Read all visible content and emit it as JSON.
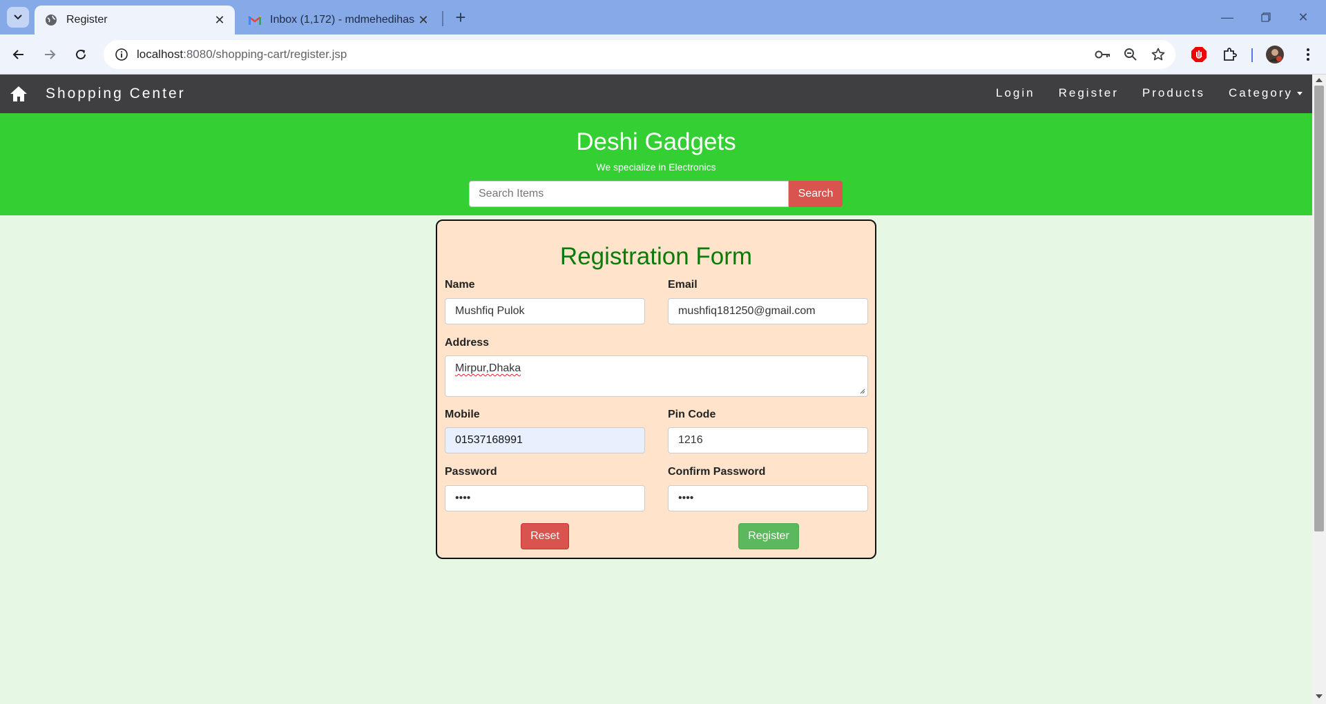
{
  "browser": {
    "tabs": [
      {
        "title": "Register",
        "active": true
      },
      {
        "title": "Inbox (1,172) - mdmehedihasan",
        "active": false
      }
    ],
    "url_host": "localhost",
    "url_path": ":8080/shopping-cart/register.jsp"
  },
  "navbar": {
    "brand": "Shopping Center",
    "links": [
      "Login",
      "Register",
      "Products",
      "Category"
    ]
  },
  "banner": {
    "title": "Deshi Gadgets",
    "subtitle": "We specialize in Electronics",
    "search_placeholder": "Search Items",
    "search_button": "Search"
  },
  "form": {
    "title": "Registration Form",
    "name_label": "Name",
    "name_value": "Mushfiq Pulok",
    "email_label": "Email",
    "email_value": "mushfiq181250@gmail.com",
    "address_label": "Address",
    "address_value": "Mirpur,Dhaka",
    "mobile_label": "Mobile",
    "mobile_value": "01537168991",
    "pincode_label": "Pin Code",
    "pincode_value": "1216",
    "password_label": "Password",
    "password_value": "••••",
    "confirm_label": "Confirm Password",
    "confirm_value": "••••",
    "reset_button": "Reset",
    "register_button": "Register"
  },
  "colors": {
    "navbar": "#3f3f41",
    "banner": "#33cf33",
    "form_bg": "#ffe3ca",
    "title_green": "#0a7a0a",
    "danger": "#d9534f",
    "success": "#5cb85c"
  }
}
